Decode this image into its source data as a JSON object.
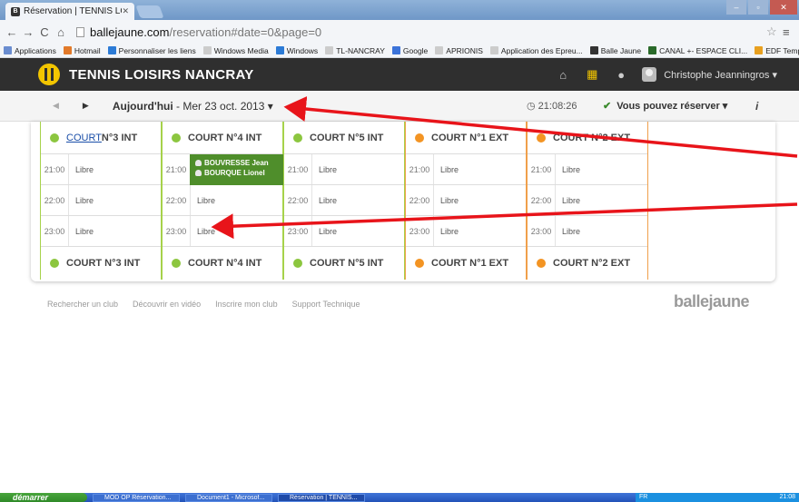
{
  "browser": {
    "tab_title": "Réservation | TENNIS LOISI",
    "tab_favicon_text": "B",
    "url_domain": "ballejaune.com",
    "url_path": "/reservation#date=0&page=0"
  },
  "bookmarks": [
    {
      "label": "Applications",
      "color": "#6a8dd0"
    },
    {
      "label": "Hotmail",
      "color": "#e27a2a"
    },
    {
      "label": "Personnaliser les liens",
      "color": "#2c7bd6"
    },
    {
      "label": "Windows Media",
      "color": "#cccccc"
    },
    {
      "label": "Windows",
      "color": "#2c7bd6"
    },
    {
      "label": "TL-NANCRAY",
      "color": "#cccccc"
    },
    {
      "label": "Google",
      "color": "#3b73d9"
    },
    {
      "label": "APRIONIS",
      "color": "#cccccc"
    },
    {
      "label": "Application des Epreu...",
      "color": "#cccccc"
    },
    {
      "label": "Balle Jaune",
      "color": "#333333"
    },
    {
      "label": "CANAL +- ESPACE CLI...",
      "color": "#2a6a2a"
    },
    {
      "label": "EDF Tempo",
      "color": "#e8a020"
    }
  ],
  "header": {
    "club_name": "TENNIS LOISIRS NANCRAY",
    "user_name": "Christophe Jeanningros",
    "user_caret": "▾"
  },
  "datebar": {
    "today": "Aujourd'hui",
    "date_rest": " - Mer 23 oct. 2013 ▾",
    "time": "21:08:26",
    "reserve_label": "Vous pouvez réserver ▾",
    "info": "i"
  },
  "courts": [
    {
      "name_prefix": "COURT",
      "name_suffix": " N°3 INT",
      "foot": "COURT N°3 INT",
      "type": "int",
      "linked": true,
      "slots": [
        {
          "time": "21:00",
          "label": "Libre"
        },
        {
          "time": "22:00",
          "label": "Libre"
        },
        {
          "time": "23:00",
          "label": "Libre"
        }
      ]
    },
    {
      "name_prefix": "",
      "name_suffix": "COURT N°4 INT",
      "foot": "COURT N°4 INT",
      "type": "int",
      "linked": false,
      "slots": [
        {
          "time": "21:00",
          "label": "",
          "booked": [
            "BOUVRESSE Jean",
            "BOURQUE Lionel"
          ]
        },
        {
          "time": "22:00",
          "label": "Libre"
        },
        {
          "time": "23:00",
          "label": "Libre"
        }
      ]
    },
    {
      "name_prefix": "",
      "name_suffix": "COURT N°5 INT",
      "foot": "COURT N°5 INT",
      "type": "int",
      "linked": false,
      "slots": [
        {
          "time": "21:00",
          "label": "Libre"
        },
        {
          "time": "22:00",
          "label": "Libre"
        },
        {
          "time": "23:00",
          "label": "Libre"
        }
      ]
    },
    {
      "name_prefix": "",
      "name_suffix": "COURT N°1 EXT",
      "foot": "COURT N°1 EXT",
      "type": "ext",
      "linked": false,
      "slots": [
        {
          "time": "21:00",
          "label": "Libre"
        },
        {
          "time": "22:00",
          "label": "Libre"
        },
        {
          "time": "23:00",
          "label": "Libre"
        }
      ]
    },
    {
      "name_prefix": "",
      "name_suffix": "COURT N°2 EXT",
      "foot": "COURT N°2 EXT",
      "type": "ext",
      "linked": false,
      "slots": [
        {
          "time": "21:00",
          "label": "Libre"
        },
        {
          "time": "22:00",
          "label": "Libre"
        },
        {
          "time": "23:00",
          "label": "Libre"
        }
      ]
    }
  ],
  "footer": {
    "links": [
      "Rechercher un club",
      "Découvrir en vidéo",
      "Inscrire mon club",
      "Support Technique"
    ],
    "brand": "ballejaune"
  },
  "taskbar": {
    "start": "démarrer",
    "tasks": [
      "MOD OP Réservation...",
      "Document1 - Microsof...",
      "Réservation | TENNIS..."
    ],
    "tray_lang": "FR",
    "tray_time": "21:08"
  },
  "colors": {
    "int_court": "#8cc63f",
    "ext_court": "#f39423",
    "booking": "#4f8e2b",
    "annotation_arrow": "#e8141a"
  }
}
